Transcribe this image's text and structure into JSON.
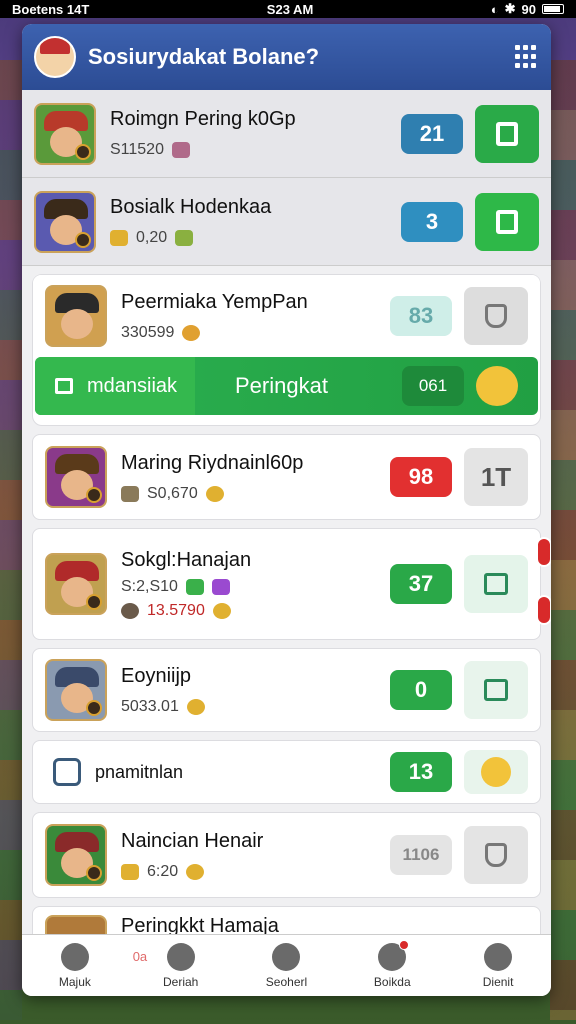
{
  "status_bar": {
    "carrier": "Boetens 14T",
    "time": "S23 AM",
    "battery": "90"
  },
  "header": {
    "title": "Sosiurydakat Bolane?"
  },
  "players": [
    {
      "name": "Roimgn Pering k0Gp",
      "sub": "S11520",
      "rank": "21",
      "rank_color": "#2f7fb0",
      "action_color": "#2aaa48",
      "dim": true
    },
    {
      "name": "Bosialk Hodenkaa",
      "sub": "0,20",
      "rank": "3",
      "rank_color": "#2f8fc0",
      "action_color": "#2eb848",
      "dim": true
    },
    {
      "name": "Peermiaka YempPan",
      "sub": "330599",
      "rank": "83",
      "rank_color": "#cfeee8",
      "action_color": "#dddddd",
      "dim": false
    },
    {
      "name": "Maring Riydnainl60p",
      "sub": "S0,670",
      "rank": "98",
      "rank_color": "#e23030",
      "action_color": "#e4e4e4",
      "action_text": "1T",
      "dim": false
    },
    {
      "name": "Sokgl:Hanajan",
      "sub": "S:2,S10",
      "sub2": "13.5790",
      "rank": "37",
      "rank_color": "#2aa848",
      "action_color": "#e4f4ea",
      "dim": false
    },
    {
      "name": "Eoyniijp",
      "sub": "5033.01",
      "rank": "0",
      "rank_color": "#2aa848",
      "action_color": "#e8f4ec",
      "dim": false
    },
    {
      "name": "Naincian Henair",
      "sub": "6:20",
      "rank": "1106",
      "rank_color": "#e4e4e4",
      "action_color": "#e4e4e4",
      "dim": false
    },
    {
      "name": "Peringkkt Hamaja",
      "sub": "",
      "rank": "",
      "dim": false
    }
  ],
  "expanded_bar": {
    "tab1": "mdansiiak",
    "tab2": "Peringkat",
    "count": "061"
  },
  "simple_row": {
    "label": "pnamitnlan",
    "count": "13"
  },
  "nav": [
    {
      "label": "Majuk",
      "badge": false
    },
    {
      "label": "Deriah",
      "badge": false
    },
    {
      "label": "Seoherl",
      "badge": false
    },
    {
      "label": "Boikda",
      "badge": true
    },
    {
      "label": "Dienit",
      "badge": false
    }
  ],
  "nav_extra": "0a",
  "colors": {
    "header": "#2c4c94",
    "green": "#2cb050",
    "red": "#e23030"
  }
}
